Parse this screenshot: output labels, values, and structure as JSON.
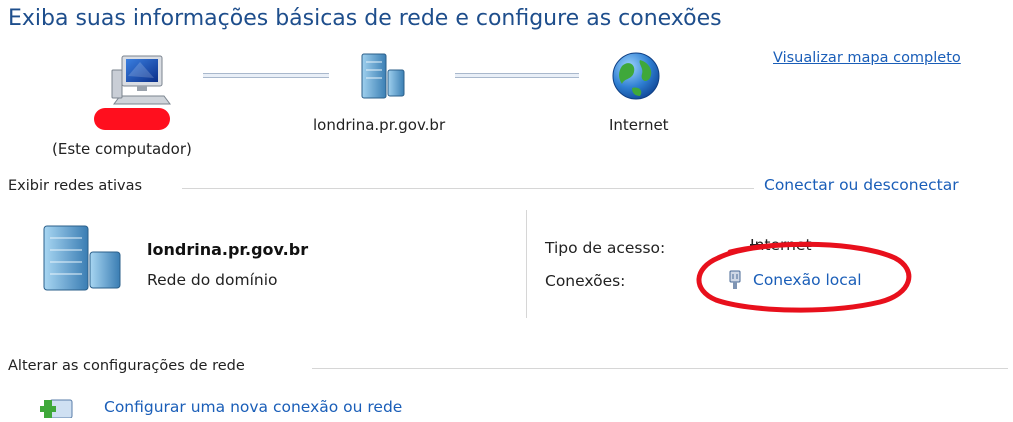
{
  "header": {
    "title": "Exiba suas informações básicas de rede e configure as conexões",
    "view_full_map": "Visualizar mapa completo"
  },
  "network_map": {
    "computer": {
      "icon": "computer-icon",
      "name": "████████",
      "sublabel": "(Este computador)"
    },
    "domain": {
      "icon": "server-icon",
      "label": "londrina.pr.gov.br"
    },
    "internet": {
      "icon": "globe-icon",
      "label": "Internet"
    }
  },
  "active_networks": {
    "header": "Exibir redes ativas",
    "connect_disconnect": "Conectar ou desconectar",
    "network": {
      "icon": "domain-network-icon",
      "name": "londrina.pr.gov.br",
      "type": "Rede do domínio"
    },
    "access_type_label": "Tipo de acesso:",
    "access_type_value": "Internet",
    "connections_label": "Conexões:",
    "connection_icon": "ethernet-icon",
    "connection_link": "Conexão local"
  },
  "change_settings": {
    "header": "Alterar as configurações de rede",
    "setup_new_connection_icon": "new-connection-icon",
    "setup_new_connection": "Configurar uma nova conexão ou rede"
  },
  "colors": {
    "title": "#1e4e8c",
    "link": "#1a5eb8",
    "redaction": "#ff0f1e",
    "annotation_circle": "#e8101c"
  }
}
